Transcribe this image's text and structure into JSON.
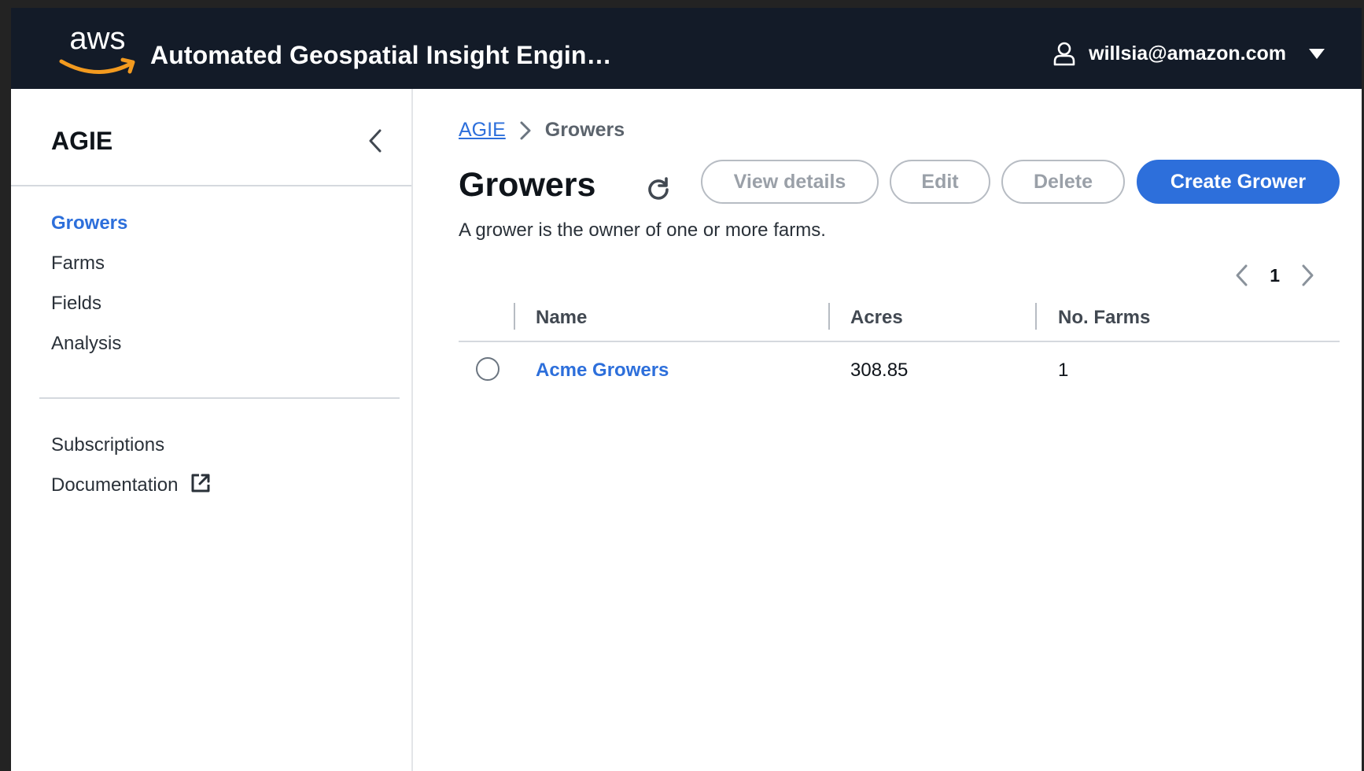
{
  "header": {
    "app_title": "Automated Geospatial Insight Engin…",
    "logo_text": "aws",
    "user_email": "willsia@amazon.com",
    "brand_color": "#131b28",
    "logo_smile_color": "#f29a1f"
  },
  "sidebar": {
    "title": "AGIE",
    "items": [
      {
        "label": "Growers",
        "active": true
      },
      {
        "label": "Farms"
      },
      {
        "label": "Fields"
      },
      {
        "label": "Analysis"
      }
    ],
    "secondary_items": [
      {
        "label": "Subscriptions"
      },
      {
        "label": "Documentation",
        "icon": "external-link-icon"
      }
    ]
  },
  "main": {
    "breadcrumb": {
      "root": "AGIE",
      "current": "Growers"
    },
    "title": "Growers",
    "description": "A grower is the owner of one or more farms.",
    "actions": {
      "view_details": "View details",
      "edit": "Edit",
      "delete": "Delete",
      "create": "Create Grower"
    },
    "pagination": {
      "current_page": "1"
    },
    "table": {
      "columns": [
        "Name",
        "Acres",
        "No. Farms"
      ],
      "rows": [
        {
          "name": "Acme Growers",
          "acres": "308.85",
          "farms": "1"
        }
      ]
    },
    "accent_color": "#2d6fdb"
  }
}
